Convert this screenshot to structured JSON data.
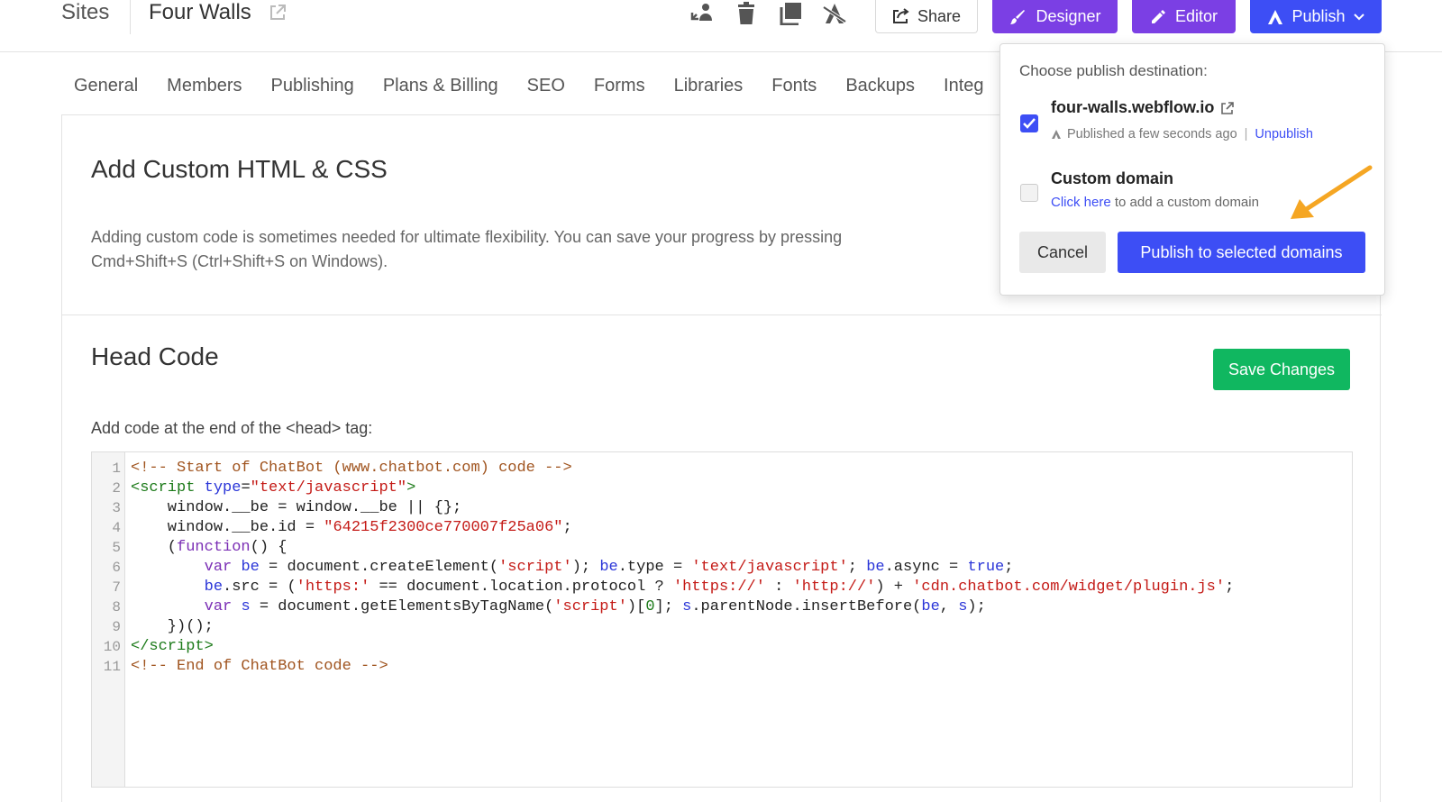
{
  "topbar": {
    "sites_label": "Sites",
    "site_name": "Four Walls",
    "share_label": "Share",
    "designer_label": "Designer",
    "editor_label": "Editor",
    "publish_label": "Publish",
    "icons": [
      "transfer-icon",
      "trash-icon",
      "duplicate-icon",
      "unpublish-icon"
    ]
  },
  "tabs": [
    {
      "label": "General"
    },
    {
      "label": "Members"
    },
    {
      "label": "Publishing"
    },
    {
      "label": "Plans & Billing"
    },
    {
      "label": "SEO"
    },
    {
      "label": "Forms"
    },
    {
      "label": "Libraries"
    },
    {
      "label": "Fonts"
    },
    {
      "label": "Backups"
    },
    {
      "label": "Integ"
    }
  ],
  "main": {
    "title": "Add Custom HTML & CSS",
    "description": "Adding custom code is sometimes needed for ultimate flexibility. You can save your progress by pressing Cmd+Shift+S (Ctrl+Shift+S on Windows).",
    "head_code_title": "Head Code",
    "save_label": "Save Changes",
    "code_label": "Add code at the end of the <head> tag:"
  },
  "code": {
    "line_numbers": [
      "1",
      "2",
      "3",
      "4",
      "5",
      "6",
      "7",
      "8",
      "9",
      "10",
      "11"
    ]
  },
  "popover": {
    "heading": "Choose publish destination:",
    "domain": "four-walls.webflow.io",
    "status": "Published a few seconds ago",
    "separator": "|",
    "unpublish": "Unpublish",
    "custom_domain_title": "Custom domain",
    "custom_domain_link": "Click here",
    "custom_domain_rest": "to add a custom domain",
    "cancel_label": "Cancel",
    "publish_selected_label": "Publish to selected domains",
    "domain_checked": true,
    "custom_checked": false
  },
  "colors": {
    "purple": "#7b3fe4",
    "blue": "#3d4ef5",
    "green": "#10b760",
    "arrow": "#f5a623"
  }
}
